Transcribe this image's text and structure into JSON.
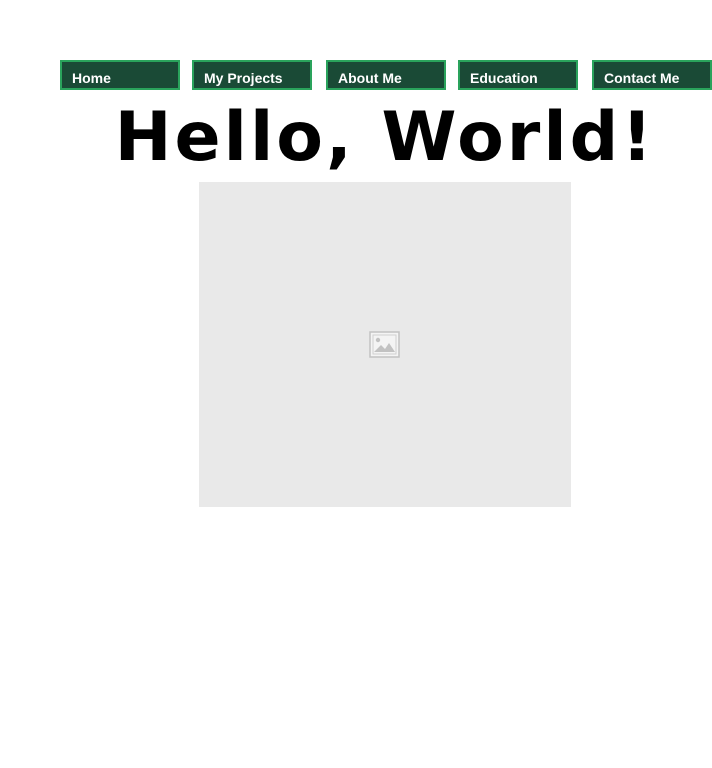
{
  "nav": {
    "items": [
      {
        "label": "Home"
      },
      {
        "label": "My Projects"
      },
      {
        "label": "About Me"
      },
      {
        "label": "Education"
      },
      {
        "label": "Contact Me"
      }
    ],
    "colors": {
      "background": "#1a4a36",
      "border": "#2aa35c",
      "text": "#ffffff"
    }
  },
  "main": {
    "heading": "Hello, World!",
    "image": {
      "icon": "broken-image-icon",
      "background": "#e9e9e9"
    }
  }
}
